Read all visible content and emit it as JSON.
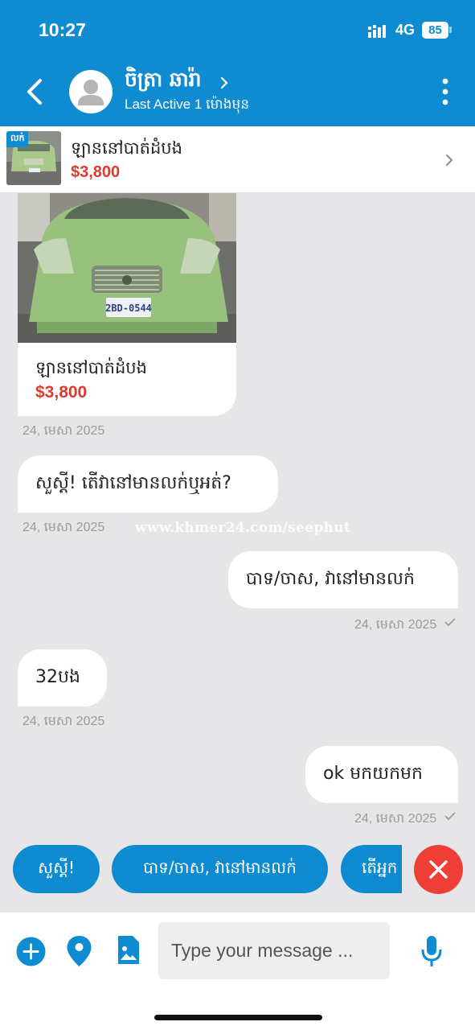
{
  "status_bar": {
    "time": "10:27",
    "network": "4G",
    "battery": "85"
  },
  "header": {
    "contact_name": "ចិត្រា ឆារ៉ា",
    "last_active": "Last Active 1 ម៉ោងមុន",
    "icons": {
      "back": "back-arrow-icon",
      "avatar": "user-avatar-icon",
      "more": "more-vertical-icon"
    }
  },
  "listing": {
    "badge": "លក់",
    "title": "ឡាននៅបាត់ដំបង",
    "price": "$3,800"
  },
  "car_card": {
    "plate": "2BD-0544",
    "title": "ឡាននៅបាត់ដំបង",
    "price": "$3,800",
    "timestamp": "24, មេសា 2025"
  },
  "messages": [
    {
      "direction": "in",
      "text": "សួស្តី! តើវានៅមានលក់ឬអត់?",
      "timestamp": "24, មេសា 2025"
    },
    {
      "direction": "out",
      "text": "បាទ/ចាស, វានៅមានលក់",
      "timestamp": "24, មេសា 2025"
    },
    {
      "direction": "in",
      "text": "32បង",
      "timestamp": "24, មេសា 2025"
    },
    {
      "direction": "out",
      "text": "ok មកយកមក",
      "timestamp": "24, មេសា 2025"
    }
  ],
  "watermark": "www.khmer24.com/seephut",
  "quick_replies": [
    "សួស្តី!",
    "បាទ/ចាស, វានៅមានលក់",
    "តើអ្នក"
  ],
  "input": {
    "placeholder": "Type your message ..."
  },
  "colors": {
    "primary": "#0f8bd2",
    "price": "#e03a2d",
    "close": "#ef3e36",
    "background": "#e6e5e7"
  },
  "toolbar_icons": [
    "add-icon",
    "location-pin-icon",
    "image-icon",
    "microphone-icon"
  ]
}
